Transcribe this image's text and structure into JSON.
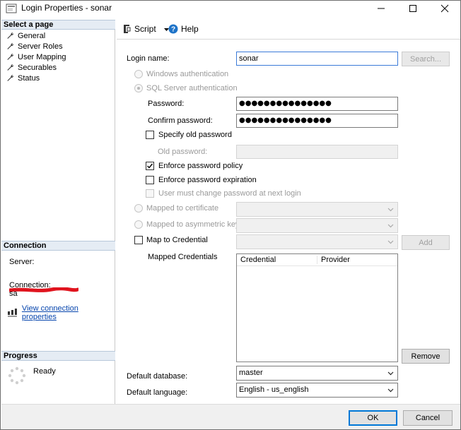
{
  "window": {
    "title": "Login Properties - sonar",
    "minimize_icon": "minimize-icon",
    "maximize_icon": "maximize-icon",
    "close_icon": "close-icon"
  },
  "left": {
    "select_page_header": "Select a page",
    "pages": [
      {
        "label": "General",
        "icon": "wrench-icon"
      },
      {
        "label": "Server Roles",
        "icon": "wrench-icon"
      },
      {
        "label": "User Mapping",
        "icon": "wrench-icon"
      },
      {
        "label": "Securables",
        "icon": "wrench-icon"
      },
      {
        "label": "Status",
        "icon": "wrench-icon"
      }
    ],
    "connection_header": "Connection",
    "server_label": "Server:",
    "connection_label": "Connection:",
    "connection_value": "sa",
    "view_connection_link": "View connection properties",
    "progress_header": "Progress",
    "progress_status": "Ready"
  },
  "toolbar": {
    "script_label": "Script",
    "help_label": "Help"
  },
  "form": {
    "login_name_label": "Login name:",
    "login_name_value": "sonar",
    "search_button": "Search...",
    "windows_auth": "Windows authentication",
    "sql_auth": "SQL Server authentication",
    "password_label": "Password:",
    "password_value": "●●●●●●●●●●●●●●●",
    "confirm_password_label": "Confirm password:",
    "confirm_password_value": "●●●●●●●●●●●●●●●",
    "specify_old_password": "Specify old password",
    "old_password_label": "Old password:",
    "enforce_policy": "Enforce password policy",
    "enforce_policy_checked": true,
    "enforce_expiration": "Enforce password expiration",
    "must_change": "User must change password at next login",
    "mapped_to_certificate": "Mapped to certificate",
    "mapped_to_asymmetric_key": "Mapped to asymmetric key",
    "map_to_credential": "Map to Credential",
    "add_button": "Add",
    "mapped_credentials_label": "Mapped Credentials",
    "grid_columns": [
      "Credential",
      "Provider"
    ],
    "remove_button": "Remove",
    "default_database_label": "Default database:",
    "default_database_value": "master",
    "default_language_label": "Default language:",
    "default_language_value": "English - us_english"
  },
  "buttons": {
    "ok": "OK",
    "cancel": "Cancel"
  },
  "colors": {
    "accent": "#0078d7",
    "link": "#0645ad",
    "section_header_bg": "#e5ecf4",
    "redaction": "#e0141e"
  }
}
